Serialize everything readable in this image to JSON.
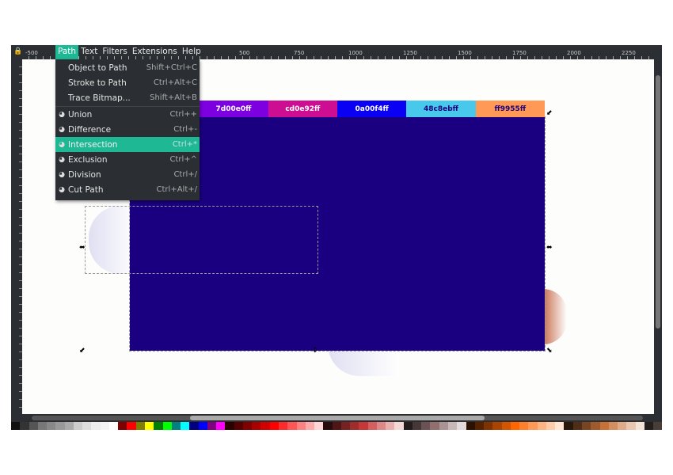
{
  "menubar": {
    "items": [
      "Path",
      "Text",
      "Filters",
      "Extensions",
      "Help"
    ],
    "active": "Path"
  },
  "ruler": {
    "labels": [
      "-500",
      "500",
      "750",
      "1000",
      "1250",
      "1500",
      "1750",
      "2000",
      "2250"
    ]
  },
  "path_menu": {
    "items": [
      {
        "label": "Object to Path",
        "shortcut": "Shift+Ctrl+C",
        "icon": ""
      },
      {
        "label": "Stroke to Path",
        "shortcut": "Ctrl+Alt+C",
        "icon": ""
      },
      {
        "label": "Trace Bitmap...",
        "shortcut": "Shift+Alt+B",
        "icon": ""
      },
      {
        "label": "Union",
        "shortcut": "Ctrl++",
        "icon": "union-icon"
      },
      {
        "label": "Difference",
        "shortcut": "Ctrl+-",
        "icon": "difference-icon"
      },
      {
        "label": "Intersection",
        "shortcut": "Ctrl+*",
        "icon": "intersection-icon",
        "highlighted": true
      },
      {
        "label": "Exclusion",
        "shortcut": "Ctrl+^",
        "icon": "exclusion-icon"
      },
      {
        "label": "Division",
        "shortcut": "Ctrl+/",
        "icon": "division-icon"
      },
      {
        "label": "Cut Path",
        "shortcut": "Ctrl+Alt+/",
        "icon": "cut-path-icon"
      }
    ]
  },
  "swatches": [
    {
      "label": "7d00e0ff",
      "color": "#7d00e0",
      "text": "#ffffff"
    },
    {
      "label": "cd0e92ff",
      "color": "#cd0e92",
      "text": "#ffffff"
    },
    {
      "label": "0a00f4ff",
      "color": "#0a00f4",
      "text": "#ffffff"
    },
    {
      "label": "48c8ebff",
      "color": "#48c8eb",
      "text": "#1a0080"
    },
    {
      "label": "ff9955ff",
      "color": "#ff9955",
      "text": "#1a0080"
    }
  ],
  "colors": {
    "accent": "#1fb894",
    "rect": "#1a0080"
  },
  "palette": [
    "#111",
    "#333",
    "#555",
    "#777",
    "#888",
    "#999",
    "#aaa",
    "#ccc",
    "#ddd",
    "#eee",
    "#f4f4f4",
    "#fff",
    "#800000",
    "#ff0000",
    "#808000",
    "#ffff00",
    "#008000",
    "#00ff00",
    "#008080",
    "#00ffff",
    "#000080",
    "#0000ff",
    "#800080",
    "#ff00ff",
    "#2a0000",
    "#550000",
    "#800000",
    "#aa0000",
    "#d40000",
    "#ff0000",
    "#ff2a2a",
    "#ff5555",
    "#ff8080",
    "#ffaaaa",
    "#ffd5d5",
    "#280b0b",
    "#501616",
    "#782121",
    "#a02c2c",
    "#c83737",
    "#d35f5f",
    "#de8787",
    "#e9afaf",
    "#f4d7d7",
    "#241c1c",
    "#483737",
    "#6c5353",
    "#916f6f",
    "#ac9393",
    "#c8b7b7",
    "#e3dbdb",
    "#2b1100",
    "#552200",
    "#803300",
    "#aa4400",
    "#d45500",
    "#ff6600",
    "#ff7f2a",
    "#ff9955",
    "#ffb380",
    "#ffccaa",
    "#ffe6d5",
    "#28170b",
    "#502d16",
    "#784421",
    "#a05a2c",
    "#c87137",
    "#d38d5f",
    "#deaa87",
    "#e9c6af",
    "#f4e3d7",
    "#241f1c",
    "#483e37"
  ]
}
